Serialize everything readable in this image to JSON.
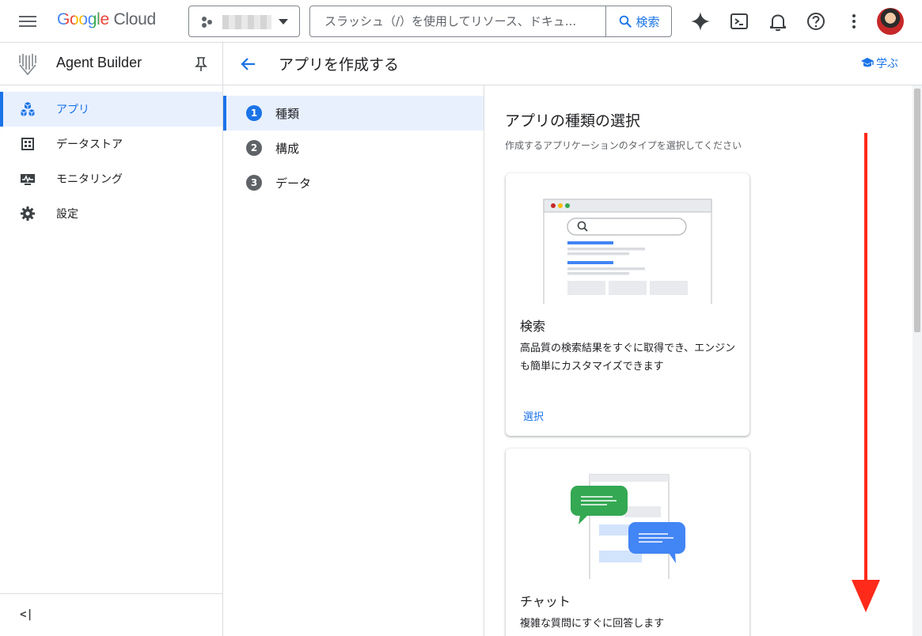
{
  "topbar": {
    "logo": {
      "google": "Google",
      "cloud": "Cloud"
    },
    "search": {
      "placeholder": "スラッシュ（/）を使用してリソース、ドキュ...",
      "button_label": "検索"
    },
    "icons": [
      "menu-icon",
      "gemini-spark-icon",
      "cloud-shell-icon",
      "notifications-icon",
      "help-icon",
      "more-vert-icon",
      "account-avatar"
    ]
  },
  "sidebar": {
    "product_name": "Agent Builder",
    "items": [
      {
        "label": "アプリ",
        "icon": "apps-cubes-icon",
        "active": true
      },
      {
        "label": "データストア",
        "icon": "data-store-icon",
        "active": false
      },
      {
        "label": "モニタリング",
        "icon": "monitoring-icon",
        "active": false
      },
      {
        "label": "設定",
        "icon": "settings-gear-icon",
        "active": false
      }
    ],
    "collapse_glyph": "<|"
  },
  "page_header": {
    "title": "アプリを作成する",
    "learn_label": "学ぶ"
  },
  "stepper": {
    "steps": [
      {
        "number": "1",
        "label": "種類",
        "active": true
      },
      {
        "number": "2",
        "label": "構成",
        "active": false
      },
      {
        "number": "3",
        "label": "データ",
        "active": false
      }
    ]
  },
  "content": {
    "title": "アプリの種類の選択",
    "subtitle": "作成するアプリケーションのタイプを選択してください",
    "cards": [
      {
        "title": "検索",
        "description": "高品質の検索結果をすぐに取得でき、エンジンも簡単にカスタマイズできます",
        "select_label": "選択"
      },
      {
        "title": "チャット",
        "description": "複雑な質問にすぐに回答します"
      }
    ]
  },
  "colors": {
    "accent": "#1a73e8",
    "active_bg": "#e8f0fe",
    "arrow": "#ff2a1a",
    "chat_green": "#34a853",
    "chat_blue": "#4285f4"
  }
}
